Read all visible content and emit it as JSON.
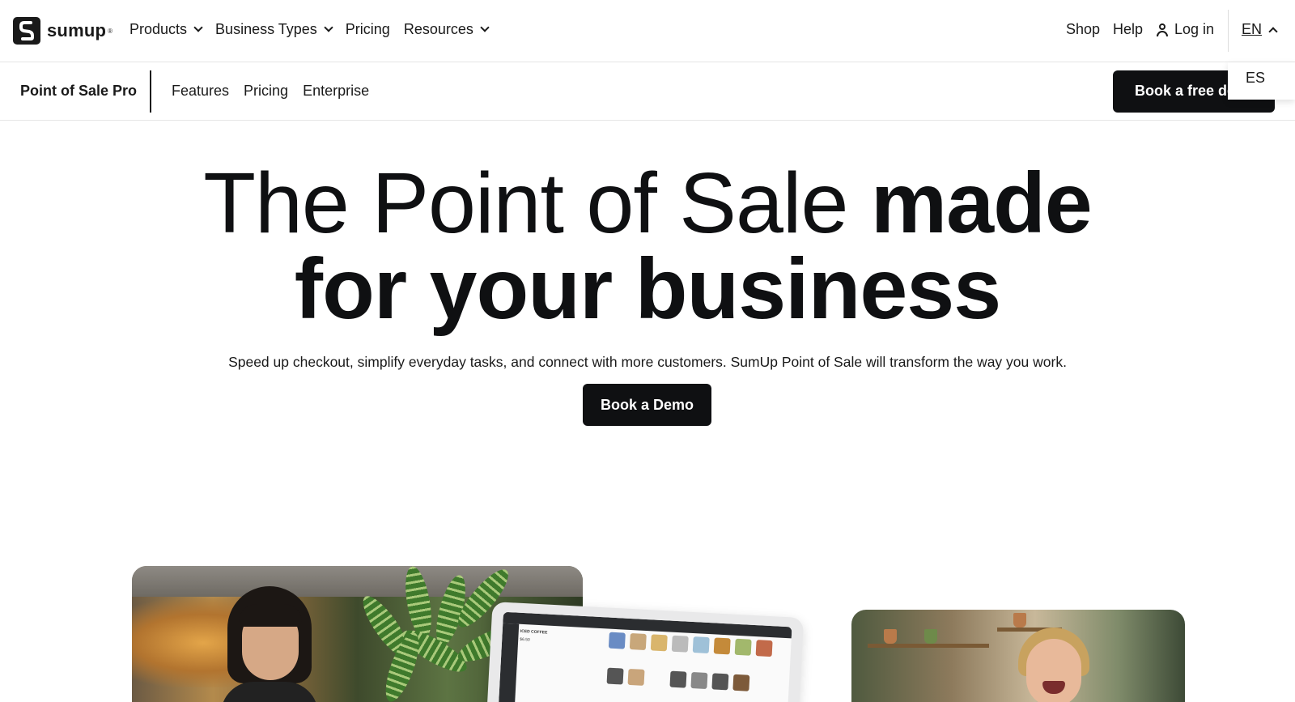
{
  "brand": {
    "name": "sumup",
    "reg": "®"
  },
  "topnav": {
    "items": [
      {
        "label": "Products",
        "dropdown": true
      },
      {
        "label": "Business Types",
        "dropdown": true
      },
      {
        "label": "Pricing",
        "dropdown": false
      },
      {
        "label": "Resources",
        "dropdown": true
      }
    ],
    "right": {
      "shop": "Shop",
      "help": "Help",
      "login": "Log in"
    },
    "language": {
      "current": "EN",
      "options": [
        "ES"
      ]
    }
  },
  "subnav": {
    "title": "Point of Sale Pro",
    "links": [
      "Features",
      "Pricing",
      "Enterprise"
    ],
    "cta": "Book a free demo"
  },
  "hero": {
    "title_light": "The Point of Sale ",
    "title_bold_1": "made",
    "title_bold_2": "for your business",
    "subtitle": "Speed up checkout, simplify everyday tasks, and connect with more customers. SumUp Point of Sale will transform the way you work.",
    "cta": "Book a Demo"
  },
  "colors": {
    "primary": "#0f1012",
    "text": "#1a1a1a",
    "border": "#e6e6e6",
    "background": "#ffffff"
  },
  "tablet": {
    "order_title": "ICED COFFEE",
    "order_price": "$6.50"
  }
}
